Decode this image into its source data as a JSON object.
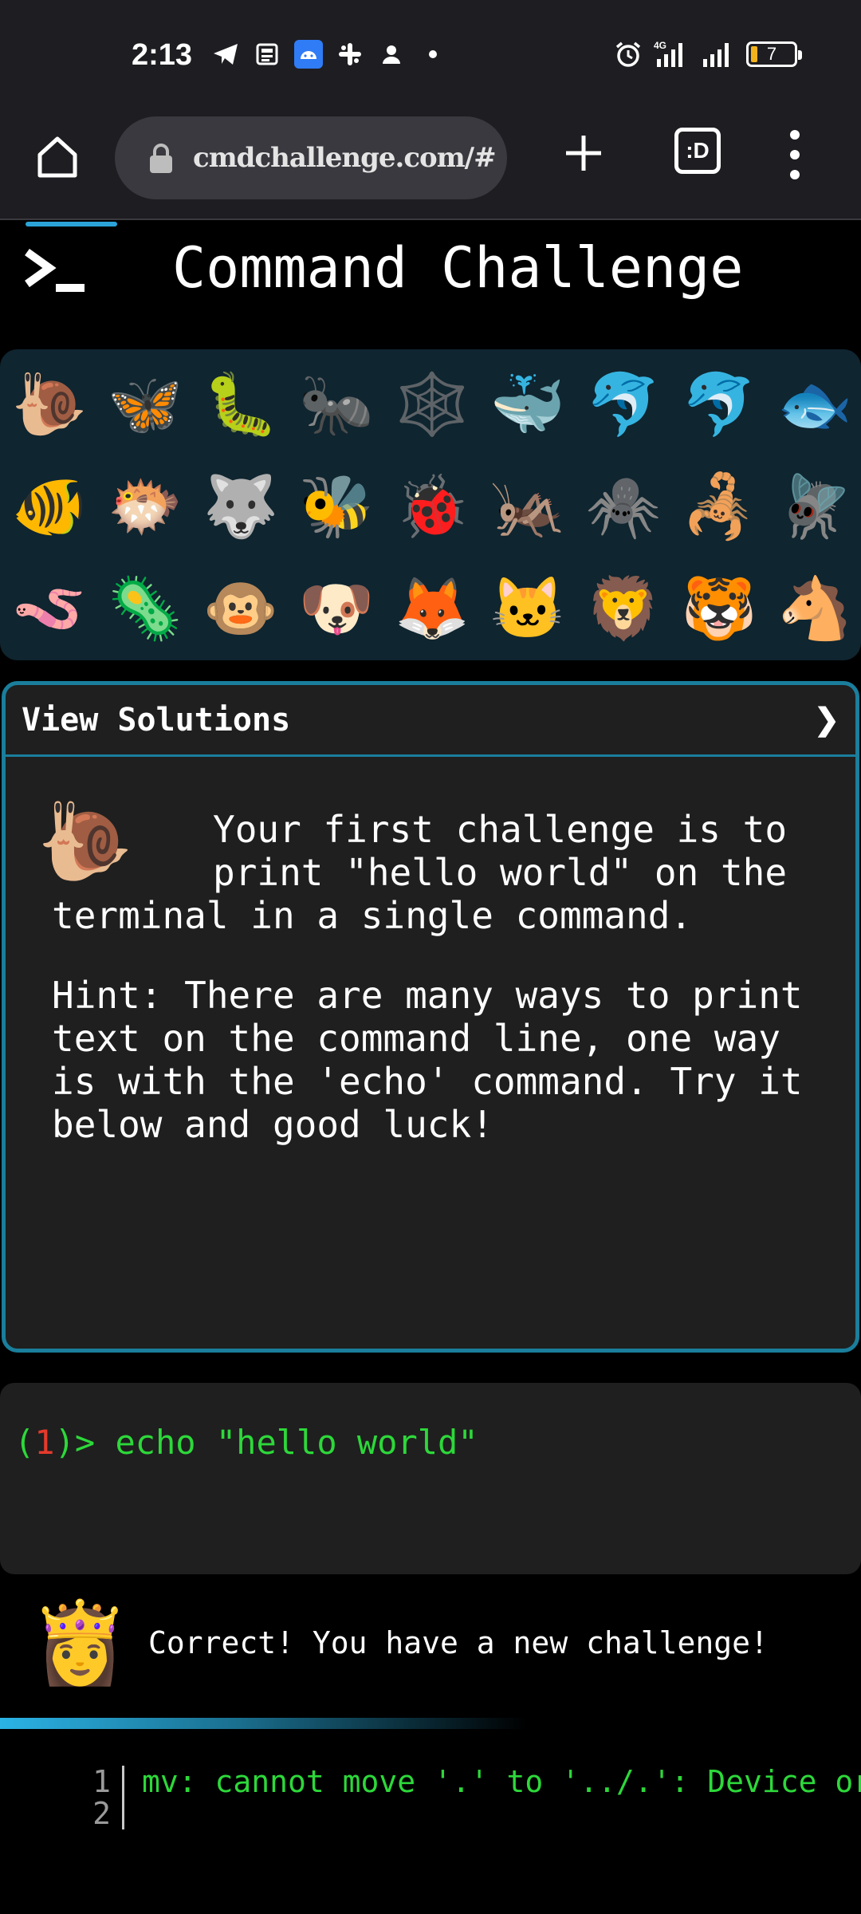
{
  "status_bar": {
    "time": "2:13",
    "network": "4G",
    "battery": "7"
  },
  "browser": {
    "url": "cmdchallenge.com/#",
    "tab_count_label": ":D"
  },
  "header": {
    "title": "Command Challenge"
  },
  "animals": [
    "🐌",
    "🦋",
    "🐛",
    "🐜",
    "🕸️",
    "🐳",
    "🐬",
    "🐬",
    "🐟",
    "🐠",
    "🐡",
    "🐺",
    "🐝",
    "🐞",
    "🦗",
    "🕷️",
    "🦂",
    "🪰",
    "🪱",
    "🦠",
    "🐵",
    "🐶",
    "🦊",
    "🐱",
    "🦁",
    "🐯",
    "🐴"
  ],
  "solutions_panel": {
    "header_label": "View Solutions",
    "chevron": "❯",
    "snail": "🐌",
    "challenge_text": "Your first challenge is to print \"hello world\" on the terminal in a single command.",
    "hint_text": "Hint: There are many ways to print text on the command line, one way is with the 'echo' command. Try it below and good luck!"
  },
  "terminal": {
    "prompt_open": "(",
    "prompt_number": "1",
    "prompt_close": ")> ",
    "command": "echo \"hello world\""
  },
  "feedback": {
    "avatar": "👸",
    "message": "Correct! You have a new challenge!"
  },
  "console": {
    "line_numbers": [
      "1",
      "2"
    ],
    "output": "mv: cannot move '.' to '../.': Device or resource busy"
  }
}
